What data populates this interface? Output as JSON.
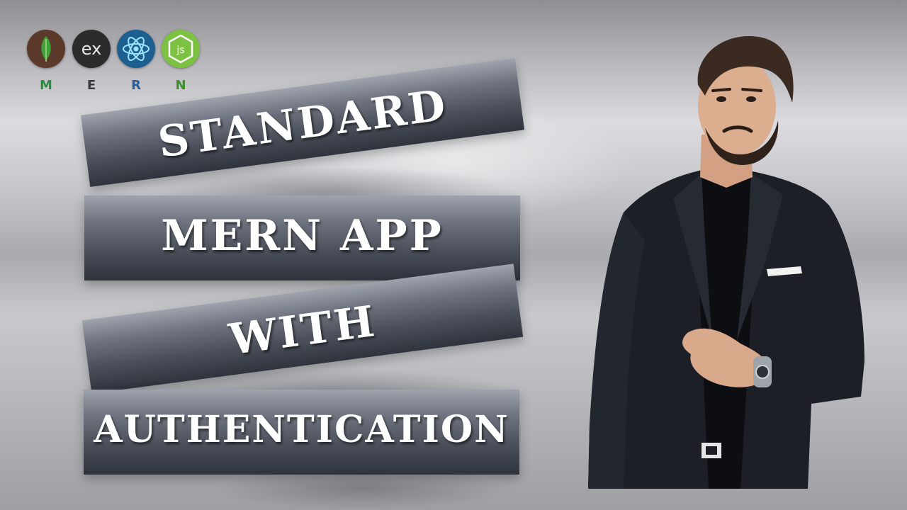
{
  "logos": [
    {
      "icon": "mongodb-leaf-icon",
      "letter": "M",
      "bg": "#5b3a2c",
      "letter_color": "#2e8b3d"
    },
    {
      "icon": "express-icon",
      "text": "ex",
      "letter": "E",
      "bg": "#2b2b2b",
      "letter_color": "#3a3a3a"
    },
    {
      "icon": "react-atom-icon",
      "letter": "R",
      "bg": "#1d5f8f",
      "letter_color": "#2b5f9a"
    },
    {
      "icon": "nodejs-hexagon-icon",
      "text": "js",
      "letter": "N",
      "bg": "#7cc142",
      "letter_color": "#3e8e2b"
    }
  ],
  "banners": {
    "line1": "STANDARD",
    "line2": "MERN APP",
    "line3": "WITH",
    "line4": "AUTHENTICATION"
  },
  "colors": {
    "banner_top": "#9fa3ad",
    "banner_bottom": "#2f333c",
    "text": "#ffffff",
    "suit": "#1c1f26"
  }
}
